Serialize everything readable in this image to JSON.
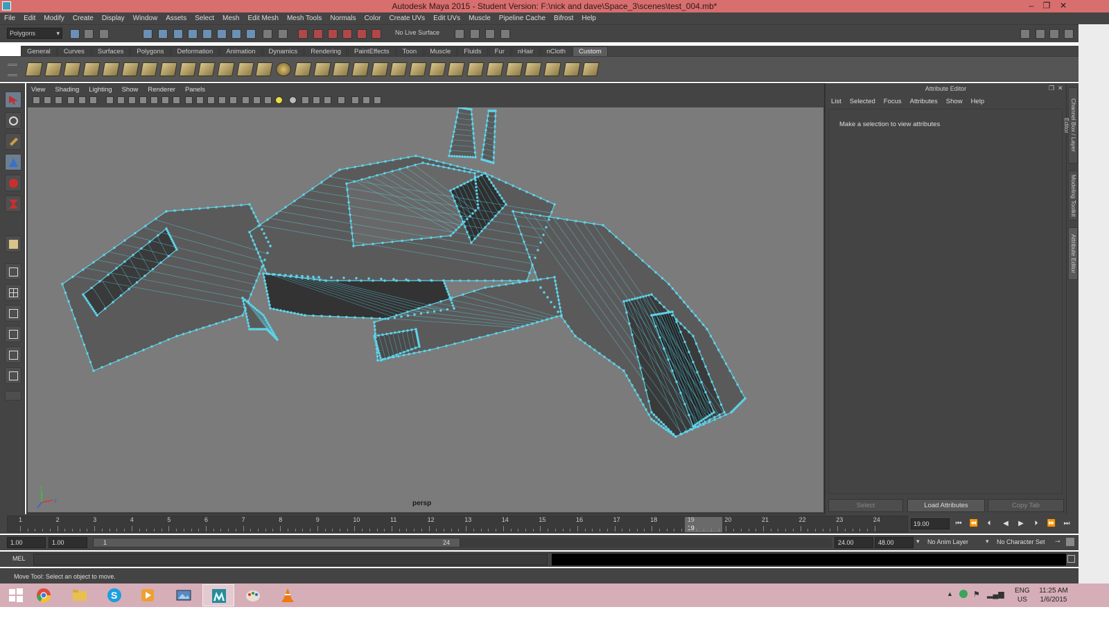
{
  "window": {
    "title": "Autodesk Maya 2015 - Student Version: F:\\nick and dave\\Space_3\\scenes\\test_004.mb*"
  },
  "menubar": [
    "File",
    "Edit",
    "Modify",
    "Create",
    "Display",
    "Window",
    "Assets",
    "Select",
    "Mesh",
    "Edit Mesh",
    "Mesh Tools",
    "Normals",
    "Color",
    "Create UVs",
    "Edit UVs",
    "Muscle",
    "Pipeline Cache",
    "Bifrost",
    "Help"
  ],
  "statusline": {
    "mode": "Polygons",
    "live_surface": "No Live Surface"
  },
  "shelf_tabs": [
    "General",
    "Curves",
    "Surfaces",
    "Polygons",
    "Deformation",
    "Animation",
    "Dynamics",
    "Rendering",
    "PaintEffects",
    "Toon",
    "Muscle",
    "Fluids",
    "Fur",
    "nHair",
    "nCloth",
    "Custom"
  ],
  "shelf_active": "Custom",
  "panel_menu": [
    "View",
    "Shading",
    "Lighting",
    "Show",
    "Renderer",
    "Panels"
  ],
  "viewport": {
    "camera": "persp",
    "axis_y": "y",
    "axis_z": "z"
  },
  "attribute_editor": {
    "title": "Attribute Editor",
    "menu": [
      "List",
      "Selected",
      "Focus",
      "Attributes",
      "Show",
      "Help"
    ],
    "message": "Make a selection to view attributes",
    "buttons": {
      "select": "Select",
      "load": "Load Attributes",
      "copy": "Copy Tab"
    }
  },
  "side_tabs": [
    "Channel Box / Layer Editor",
    "Modeling Toolkit",
    "Attribute Editor"
  ],
  "timeline": {
    "ticks": [
      "1",
      "2",
      "3",
      "4",
      "5",
      "6",
      "7",
      "8",
      "9",
      "10",
      "11",
      "12",
      "13",
      "14",
      "15",
      "16",
      "17",
      "18",
      "19",
      "20",
      "21",
      "22",
      "23",
      "24"
    ],
    "current_frame": "19",
    "current_field": "19.00"
  },
  "range": {
    "start": "1.00",
    "start_anim": "1.00",
    "bar_start": "1",
    "bar_end": "24",
    "end": "24.00",
    "end_anim": "48.00",
    "anim_layer": "No Anim Layer",
    "character_set": "No Character Set"
  },
  "command_line": {
    "label": "MEL"
  },
  "help_line": "Move Tool: Select an object to move.",
  "taskbar": {
    "apps": [
      "chrome",
      "file-explorer",
      "skype",
      "media-player",
      "image-viewer",
      "maya",
      "paint",
      "vlc"
    ],
    "active": "maya",
    "lang_top": "ENG",
    "lang_bottom": "US",
    "time": "11:25 AM",
    "date": "1/6/2015"
  },
  "colors": {
    "wire": "#5fd4ea",
    "titlebar": "#d86e6e",
    "taskbar": "#d5aeb8",
    "viewport_bg": "#7b7b7b"
  }
}
